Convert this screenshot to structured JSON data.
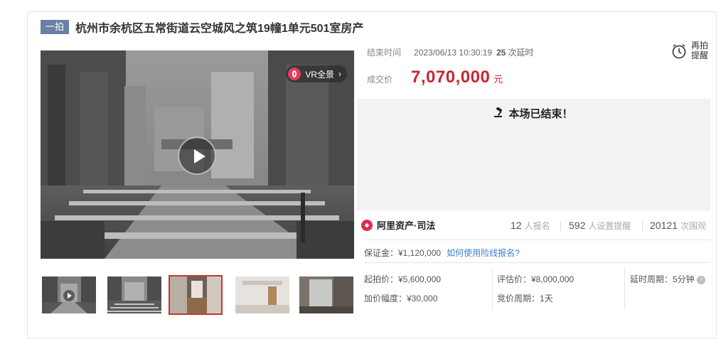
{
  "header": {
    "tag": "一拍",
    "title": "杭州市余杭区五常街道云空城风之筑19幢1单元501室房产"
  },
  "media": {
    "vr_label": "VR全景",
    "thumbnails": [
      {
        "kind": "video",
        "active": false
      },
      {
        "kind": "image",
        "active": false
      },
      {
        "kind": "image",
        "active": true
      },
      {
        "kind": "image",
        "active": false
      },
      {
        "kind": "image",
        "active": false
      }
    ]
  },
  "auction": {
    "end_label": "结束时间",
    "end_time": "2023/06/13 10:30:19",
    "extend_count": "25",
    "extend_label": "次延时",
    "remind_line1": "再拍",
    "remind_line2": "提醒",
    "deal_label": "成交价",
    "deal_price": "7,070,000",
    "deal_unit": "元",
    "ended_text": "本场已结束！"
  },
  "stats": {
    "brand": "阿里资产·司法",
    "signups": "12",
    "signups_label": "人报名",
    "reminders": "592",
    "reminders_label": "人设置提醒",
    "views": "20121",
    "views_label": "次围观"
  },
  "terms": {
    "deposit": "保证金：¥1,120,000",
    "deposit_link": "如何使用险线报名?",
    "start_price": "起拍价：¥5,600,000",
    "increment": "加价幅度：¥30,000",
    "appraisal": "评估价：¥8,000,000",
    "bid_period": "竞价周期：1天",
    "delay_period": "延时周期：5分钟"
  },
  "colors": {
    "accent": "#c7272f",
    "tag_bg": "#6a7fa6",
    "link": "#3b7fd1",
    "brand": "#e02d4f"
  }
}
